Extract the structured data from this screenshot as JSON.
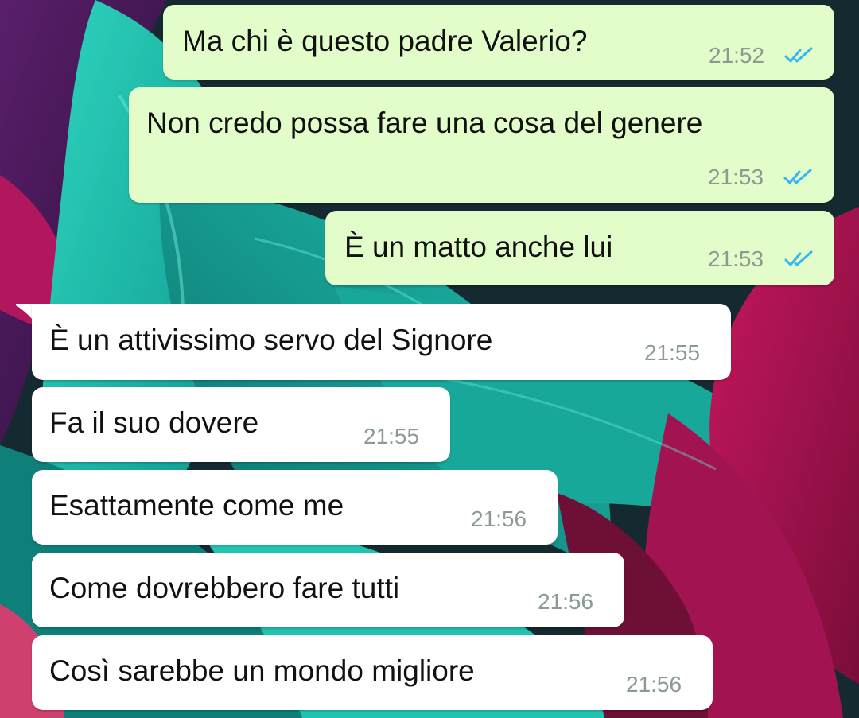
{
  "conversation": {
    "messages": [
      {
        "direction": "outgoing",
        "text": "Ma chi è questo padre Valerio?",
        "time": "21:52",
        "status_icon": "double-check-read-icon"
      },
      {
        "direction": "outgoing",
        "text": "Non credo possa fare una cosa del genere",
        "time": "21:53",
        "status_icon": "double-check-read-icon"
      },
      {
        "direction": "outgoing",
        "text": "È un matto anche lui",
        "time": "21:53",
        "status_icon": "double-check-read-icon"
      },
      {
        "direction": "incoming",
        "text": "È un attivissimo servo del Signore",
        "time": "21:55"
      },
      {
        "direction": "incoming",
        "text": "Fa il suo dovere",
        "time": "21:55"
      },
      {
        "direction": "incoming",
        "text": "Esattamente come me",
        "time": "21:56"
      },
      {
        "direction": "incoming",
        "text": "Come dovrebbero fare tutti",
        "time": "21:56"
      },
      {
        "direction": "incoming",
        "text": "Così sarebbe un mondo migliore",
        "time": "21:56"
      }
    ]
  },
  "colors": {
    "outgoing_bubble": "#e2fdc9",
    "incoming_bubble": "#ffffff",
    "read_ticks": "#34b7f1",
    "timestamp": "#8c9a94"
  }
}
